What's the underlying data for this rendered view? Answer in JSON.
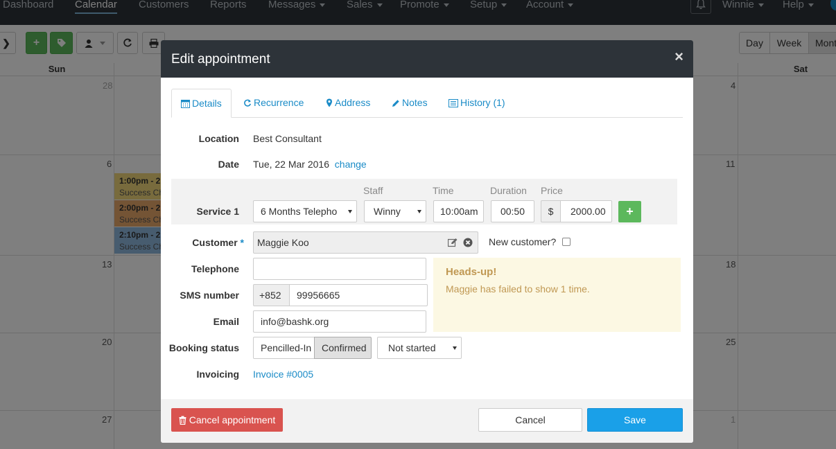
{
  "topnav": {
    "items": [
      "Dashboard",
      "Calendar",
      "Customers",
      "Reports",
      "Messages",
      "Sales",
      "Promote",
      "Setup",
      "Account"
    ],
    "user": "Winnie",
    "help": "Help"
  },
  "toolbar": {
    "views": [
      "Day",
      "Week",
      "Mont"
    ]
  },
  "calendar": {
    "days": [
      "Sun",
      "Sat"
    ],
    "dates": [
      "28",
      "4",
      "6",
      "11",
      "13",
      "18",
      "20",
      "25",
      "27",
      "1"
    ],
    "events": [
      {
        "time": "1:00pm - 2",
        "title": "Success Ch",
        "color": "#f0d77a"
      },
      {
        "time": "2:00pm - 2",
        "title": "Success Ch",
        "color": "#e8a86b"
      },
      {
        "time": "2:10pm - 2",
        "title": "Success Ch",
        "color": "#8fb8de"
      }
    ]
  },
  "modal": {
    "title": "Edit appointment",
    "close": "×",
    "tabs": [
      "Details",
      "Recurrence",
      "Address",
      "Notes",
      "History (1)"
    ],
    "location_label": "Location",
    "location": "Best Consultant",
    "date_label": "Date",
    "date": "Tue, 22 Mar 2016",
    "date_change": "change",
    "service": {
      "label": "Service 1",
      "name": "6 Months Telepho",
      "staff_label": "Staff",
      "staff": "Winny",
      "time_label": "Time",
      "time": "10:00am",
      "duration_label": "Duration",
      "duration": "00:50",
      "price_label": "Price",
      "currency": "$",
      "price": "2000.00",
      "add": "+"
    },
    "customer_label": "Customer",
    "customer_required": "*",
    "customer": "Maggie Koo",
    "new_customer": "New customer?",
    "telephone_label": "Telephone",
    "telephone": "",
    "sms_label": "SMS number",
    "sms_prefix": "+852",
    "sms": "99956665",
    "email_label": "Email",
    "email": "info@bashk.org",
    "alert_title": "Heads-up!",
    "alert_text": "Maggie has failed to show 1 time.",
    "booking_label": "Booking status",
    "booking_options": [
      "Pencilled-In",
      "Confirmed"
    ],
    "booking_progress": "Not started",
    "invoicing_label": "Invoicing",
    "invoice": "Invoice #0005",
    "cancel_appt": "Cancel appointment",
    "cancel": "Cancel",
    "save": "Save"
  }
}
